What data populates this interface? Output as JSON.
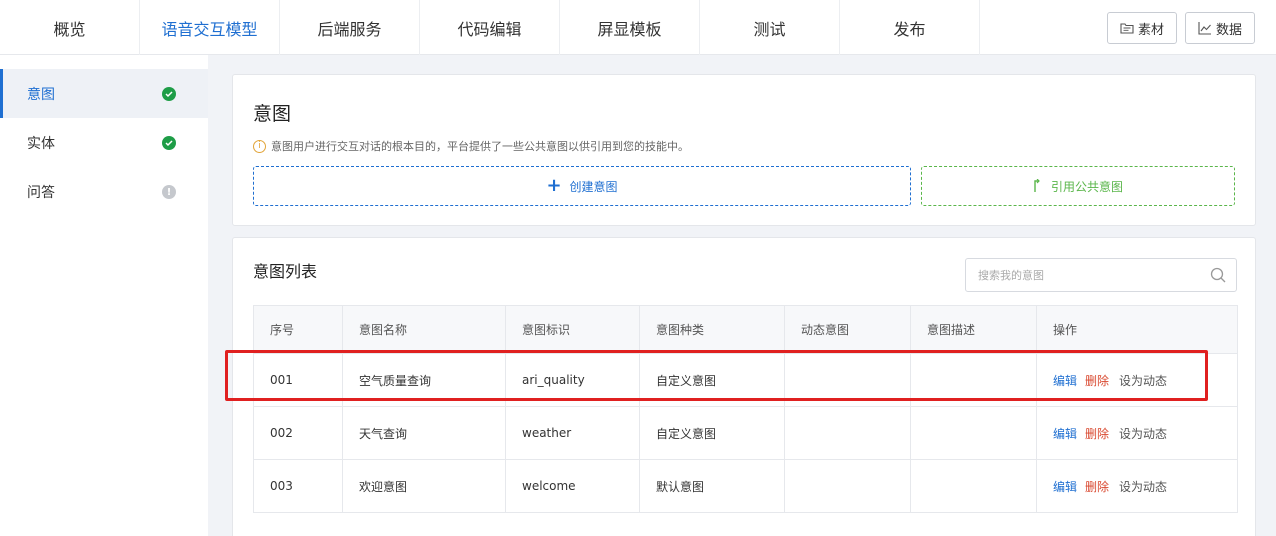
{
  "topnav": {
    "tabs": [
      {
        "label": "概览"
      },
      {
        "label": "语音交互模型"
      },
      {
        "label": "后端服务"
      },
      {
        "label": "代码编辑"
      },
      {
        "label": "屏显模板"
      },
      {
        "label": "测试"
      },
      {
        "label": "发布"
      }
    ],
    "active_tab": "语音交互模型",
    "materials_label": "素材",
    "data_label": "数据"
  },
  "sidebar": {
    "items": [
      {
        "label": "意图",
        "status": "complete"
      },
      {
        "label": "实体",
        "status": "complete"
      },
      {
        "label": "问答",
        "status": "incomplete"
      }
    ],
    "active": "意图"
  },
  "intent_card": {
    "title": "意图",
    "info_text": "意图用户进行交互对话的根本目的，平台提供了一些公共意图以供引用到您的技能中。",
    "create_label": "创建意图",
    "public_label": "引用公共意图"
  },
  "list_card": {
    "title": "意图列表",
    "search_placeholder": "搜索我的意图",
    "columns": [
      "序号",
      "意图名称",
      "意图标识",
      "意图种类",
      "动态意图",
      "意图描述",
      "操作"
    ],
    "rows": [
      {
        "index": "001",
        "name": "空气质量查询",
        "id": "ari_quality",
        "kind": "自定义意图",
        "dynamic": "",
        "desc": ""
      },
      {
        "index": "002",
        "name": "天气查询",
        "id": "weather",
        "kind": "自定义意图",
        "dynamic": "",
        "desc": ""
      },
      {
        "index": "003",
        "name": "欢迎意图",
        "id": "welcome",
        "kind": "默认意图",
        "dynamic": "",
        "desc": ""
      }
    ],
    "actions": {
      "edit": "编辑",
      "delete": "删除",
      "set_dynamic": "设为动态"
    }
  },
  "colors": {
    "accent": "#1f6fd1",
    "success": "#1e9d47",
    "public_green": "#5ab64a",
    "delete_red": "#d9482f",
    "highlight_red": "#e02020"
  }
}
